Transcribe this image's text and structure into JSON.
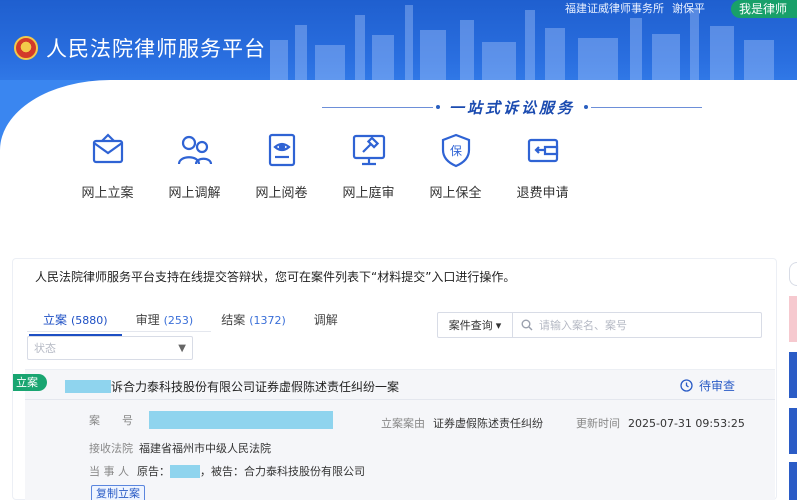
{
  "header": {
    "site_title": "人民法院律师服务平台",
    "firm_name": "福建证威律师事务所",
    "user_name": "谢保平",
    "role_button": "我是律师"
  },
  "slogan": "一站式诉讼服务",
  "services": [
    {
      "label": "网上立案",
      "icon": "envelope-icon"
    },
    {
      "label": "网上调解",
      "icon": "people-icon"
    },
    {
      "label": "网上阅卷",
      "icon": "document-eye-icon"
    },
    {
      "label": "网上庭审",
      "icon": "gavel-screen-icon"
    },
    {
      "label": "网上保全",
      "icon": "shield-bao-icon"
    },
    {
      "label": "退费申请",
      "icon": "wallet-icon"
    }
  ],
  "notice": "人民法院律师服务平台支持在线提交答辩状，您可在案件列表下“材料提交”入口进行操作。",
  "tabs": [
    {
      "label": "立案",
      "count": "(5880)",
      "active": true
    },
    {
      "label": "审理",
      "count": "(253)"
    },
    {
      "label": "结案",
      "count": "(1372)"
    },
    {
      "label": "调解",
      "count": ""
    }
  ],
  "search": {
    "type_label": "案件查询",
    "placeholder": "请输入案名、案号"
  },
  "status_select": {
    "placeholder": "状态"
  },
  "case": {
    "tag": "立案",
    "title_suffix": "诉合力泰科技股份有限公司证券虚假陈述责任纠纷一案",
    "status": "待审查",
    "case_no_label": "案　　号",
    "cause_label": "立案案由",
    "cause_value": "证券虚假陈述责任纠纷",
    "updated_label": "更新时间",
    "updated_value": "2025-07-31 09:53:25",
    "court_label": "接收法院",
    "court_value": "福建省福州市中级人民法院",
    "party_label": "当 事 人",
    "plaintiff_prefix": "原告：",
    "defendant_text": "，被告：合力泰科技股份有限公司",
    "copy_button": "复制立案"
  },
  "colors": {
    "brand_blue": "#1f5fcf",
    "accent_green": "#19a571",
    "link_blue": "#2b5cc6",
    "redaction": "#8fd4ee"
  }
}
